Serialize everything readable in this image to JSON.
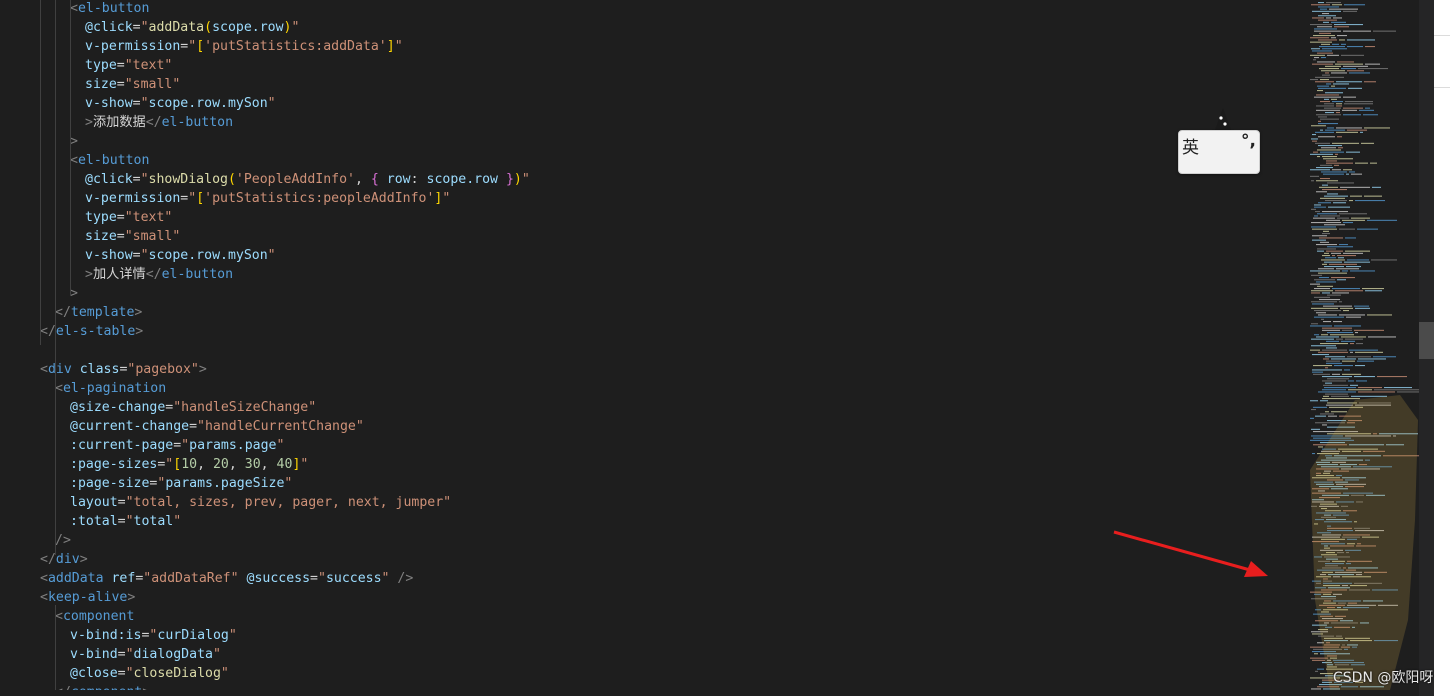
{
  "code_lines": [
    [
      [
        "punc",
        "<"
      ],
      [
        "tag",
        "el-button"
      ]
    ],
    [
      [
        "attr",
        "@click"
      ],
      [
        "text",
        "="
      ],
      [
        "str",
        "\""
      ],
      [
        "fn",
        "addData"
      ],
      [
        "br1",
        "("
      ],
      [
        "var",
        "scope.row"
      ],
      [
        "br1",
        ")"
      ],
      [
        "str",
        "\""
      ]
    ],
    [
      [
        "attr",
        "v-permission"
      ],
      [
        "text",
        "="
      ],
      [
        "str",
        "\""
      ],
      [
        "br1",
        "["
      ],
      [
        "str",
        "'putStatistics:addData'"
      ],
      [
        "br1",
        "]"
      ],
      [
        "str",
        "\""
      ]
    ],
    [
      [
        "attr",
        "type"
      ],
      [
        "text",
        "="
      ],
      [
        "str",
        "\"text\""
      ]
    ],
    [
      [
        "attr",
        "size"
      ],
      [
        "text",
        "="
      ],
      [
        "str",
        "\"small\""
      ]
    ],
    [
      [
        "attr",
        "v-show"
      ],
      [
        "text",
        "="
      ],
      [
        "str",
        "\""
      ],
      [
        "var",
        "scope.row.mySon"
      ],
      [
        "str",
        "\""
      ]
    ],
    [
      [
        "punc",
        ">"
      ],
      [
        "text",
        "添加数据"
      ],
      [
        "punc",
        "</"
      ],
      [
        "tag",
        "el-button"
      ]
    ],
    [
      [
        "punc",
        ">"
      ]
    ],
    [
      [
        "punc",
        "<"
      ],
      [
        "tag",
        "el-button"
      ]
    ],
    [
      [
        "attr",
        "@click"
      ],
      [
        "text",
        "="
      ],
      [
        "str",
        "\""
      ],
      [
        "fn",
        "showDialog"
      ],
      [
        "br1",
        "("
      ],
      [
        "str",
        "'PeopleAddInfo'"
      ],
      [
        "text",
        ", "
      ],
      [
        "br2",
        "{"
      ],
      [
        "text",
        " "
      ],
      [
        "var",
        "row"
      ],
      [
        "text",
        ": "
      ],
      [
        "var",
        "scope.row"
      ],
      [
        "text",
        " "
      ],
      [
        "br2",
        "}"
      ],
      [
        "br1",
        ")"
      ],
      [
        "str",
        "\""
      ]
    ],
    [
      [
        "attr",
        "v-permission"
      ],
      [
        "text",
        "="
      ],
      [
        "str",
        "\""
      ],
      [
        "br1",
        "["
      ],
      [
        "str",
        "'putStatistics:peopleAddInfo'"
      ],
      [
        "br1",
        "]"
      ],
      [
        "str",
        "\""
      ]
    ],
    [
      [
        "attr",
        "type"
      ],
      [
        "text",
        "="
      ],
      [
        "str",
        "\"text\""
      ]
    ],
    [
      [
        "attr",
        "size"
      ],
      [
        "text",
        "="
      ],
      [
        "str",
        "\"small\""
      ]
    ],
    [
      [
        "attr",
        "v-show"
      ],
      [
        "text",
        "="
      ],
      [
        "str",
        "\""
      ],
      [
        "var",
        "scope.row.mySon"
      ],
      [
        "str",
        "\""
      ]
    ],
    [
      [
        "punc",
        ">"
      ],
      [
        "text",
        "加人详情"
      ],
      [
        "punc",
        "</"
      ],
      [
        "tag",
        "el-button"
      ]
    ],
    [
      [
        "punc",
        ">"
      ]
    ],
    [
      [
        "punc",
        "</"
      ],
      [
        "tag",
        "template"
      ],
      [
        "punc",
        ">"
      ]
    ],
    [
      [
        "punc",
        "</"
      ],
      [
        "tag",
        "el-s-table"
      ],
      [
        "punc",
        ">"
      ]
    ],
    [],
    [
      [
        "punc",
        "<"
      ],
      [
        "tag",
        "div"
      ],
      [
        "text",
        " "
      ],
      [
        "attr",
        "class"
      ],
      [
        "text",
        "="
      ],
      [
        "str",
        "\"pagebox\""
      ],
      [
        "punc",
        ">"
      ]
    ],
    [
      [
        "punc",
        "<"
      ],
      [
        "tag",
        "el-pagination"
      ]
    ],
    [
      [
        "attr",
        "@size-change"
      ],
      [
        "text",
        "="
      ],
      [
        "str",
        "\"handleSizeChange\""
      ]
    ],
    [
      [
        "attr",
        "@current-change"
      ],
      [
        "text",
        "="
      ],
      [
        "str",
        "\"handleCurrentChange\""
      ]
    ],
    [
      [
        "attr",
        ":current-page"
      ],
      [
        "text",
        "="
      ],
      [
        "str",
        "\""
      ],
      [
        "var",
        "params.page"
      ],
      [
        "str",
        "\""
      ]
    ],
    [
      [
        "attr",
        ":page-sizes"
      ],
      [
        "text",
        "="
      ],
      [
        "str",
        "\""
      ],
      [
        "br1",
        "["
      ],
      [
        "num",
        "10"
      ],
      [
        "text",
        ", "
      ],
      [
        "num",
        "20"
      ],
      [
        "text",
        ", "
      ],
      [
        "num",
        "30"
      ],
      [
        "text",
        ", "
      ],
      [
        "num",
        "40"
      ],
      [
        "br1",
        "]"
      ],
      [
        "str",
        "\""
      ]
    ],
    [
      [
        "attr",
        ":page-size"
      ],
      [
        "text",
        "="
      ],
      [
        "str",
        "\""
      ],
      [
        "var",
        "params.pageSize"
      ],
      [
        "str",
        "\""
      ]
    ],
    [
      [
        "attr",
        "layout"
      ],
      [
        "text",
        "="
      ],
      [
        "str",
        "\"total, sizes, prev, pager, next, jumper\""
      ]
    ],
    [
      [
        "attr",
        ":total"
      ],
      [
        "text",
        "="
      ],
      [
        "str",
        "\""
      ],
      [
        "var",
        "total"
      ],
      [
        "str",
        "\""
      ]
    ],
    [
      [
        "punc",
        "/>"
      ]
    ],
    [
      [
        "punc",
        "</"
      ],
      [
        "tag",
        "div"
      ],
      [
        "punc",
        ">"
      ]
    ],
    [
      [
        "punc",
        "<"
      ],
      [
        "tag",
        "addData"
      ],
      [
        "text",
        " "
      ],
      [
        "attr",
        "ref"
      ],
      [
        "text",
        "="
      ],
      [
        "str",
        "\"addDataRef\""
      ],
      [
        "text",
        " "
      ],
      [
        "attr",
        "@success"
      ],
      [
        "text",
        "="
      ],
      [
        "str",
        "\""
      ],
      [
        "var",
        "success"
      ],
      [
        "str",
        "\""
      ],
      [
        "text",
        " "
      ],
      [
        "punc",
        "/>"
      ]
    ],
    [
      [
        "punc",
        "<"
      ],
      [
        "tag",
        "keep-alive"
      ],
      [
        "punc",
        ">"
      ]
    ],
    [
      [
        "punc",
        "<"
      ],
      [
        "tag",
        "component"
      ]
    ],
    [
      [
        "attr",
        "v-bind:is"
      ],
      [
        "text",
        "="
      ],
      [
        "str",
        "\""
      ],
      [
        "var",
        "curDialog"
      ],
      [
        "str",
        "\""
      ]
    ],
    [
      [
        "attr",
        "v-bind"
      ],
      [
        "text",
        "="
      ],
      [
        "str",
        "\""
      ],
      [
        "var",
        "dialogData"
      ],
      [
        "str",
        "\""
      ]
    ],
    [
      [
        "attr",
        "@close"
      ],
      [
        "text",
        "="
      ],
      [
        "str",
        "\""
      ],
      [
        "fn",
        "closeDialog"
      ],
      [
        "str",
        "\""
      ]
    ],
    [
      [
        "punc",
        "</"
      ],
      [
        "tag",
        "component"
      ],
      [
        "punc",
        ">"
      ]
    ]
  ],
  "ime": {
    "language": "英",
    "punctuation": "°,"
  },
  "watermark": "CSDN @欧阳呀",
  "colors": {
    "background": "#1e1e1e",
    "tag": "#569cd6",
    "attribute": "#9cdcfe",
    "string": "#ce9178",
    "function": "#dcdcaa",
    "number": "#b5cea8",
    "bracket_1": "#ffd700",
    "bracket_2": "#da70d6",
    "annotation_arrow": "#e81e1e"
  },
  "icons": {
    "ime_mascot": "dog-with-hat-icon",
    "annotation": "red-arrow-icon"
  }
}
